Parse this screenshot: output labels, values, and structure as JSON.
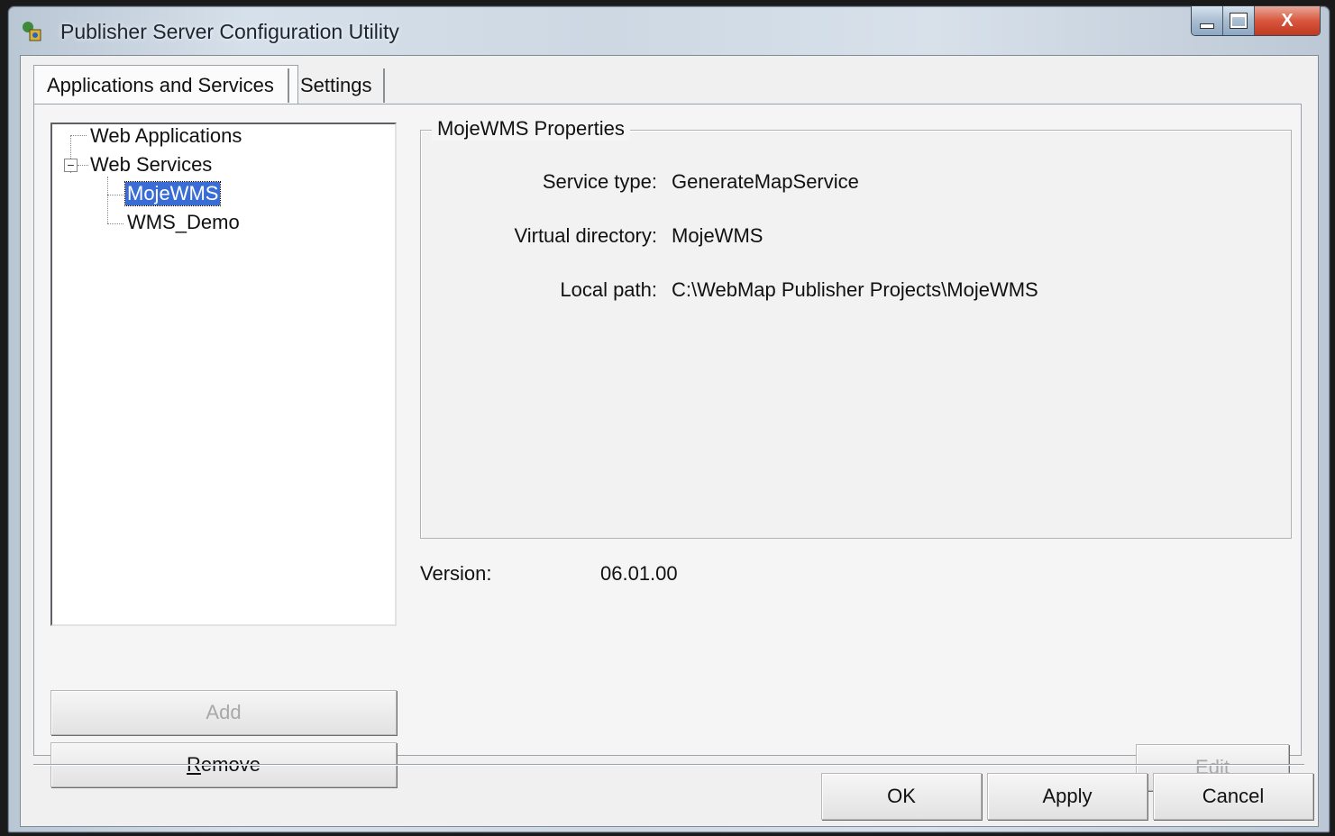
{
  "window": {
    "title": "Publisher Server Configuration Utility",
    "close_glyph": "X"
  },
  "tabs": [
    {
      "label": "Applications and Services"
    },
    {
      "label": "Settings"
    }
  ],
  "tree": {
    "items": [
      {
        "label": "Web Applications"
      },
      {
        "label": "Web Services",
        "expander": "−"
      },
      {
        "label": "MojeWMS"
      },
      {
        "label": "WMS_Demo"
      }
    ]
  },
  "left_buttons": {
    "add": "Add",
    "remove_prefix": "R",
    "remove_rest": "emove"
  },
  "properties": {
    "title": "MojeWMS Properties",
    "service_type_label": "Service type:",
    "service_type_value": "GenerateMapService",
    "virtual_directory_label": "Virtual directory:",
    "virtual_directory_value": "MojeWMS",
    "local_path_label": "Local path:",
    "local_path_value": "C:\\WebMap Publisher Projects\\MojeWMS"
  },
  "version": {
    "label": "Version:",
    "value": "06.01.00"
  },
  "edit_button": "Edit",
  "dialog_buttons": {
    "ok": "OK",
    "apply": "Apply",
    "cancel": "Cancel"
  }
}
